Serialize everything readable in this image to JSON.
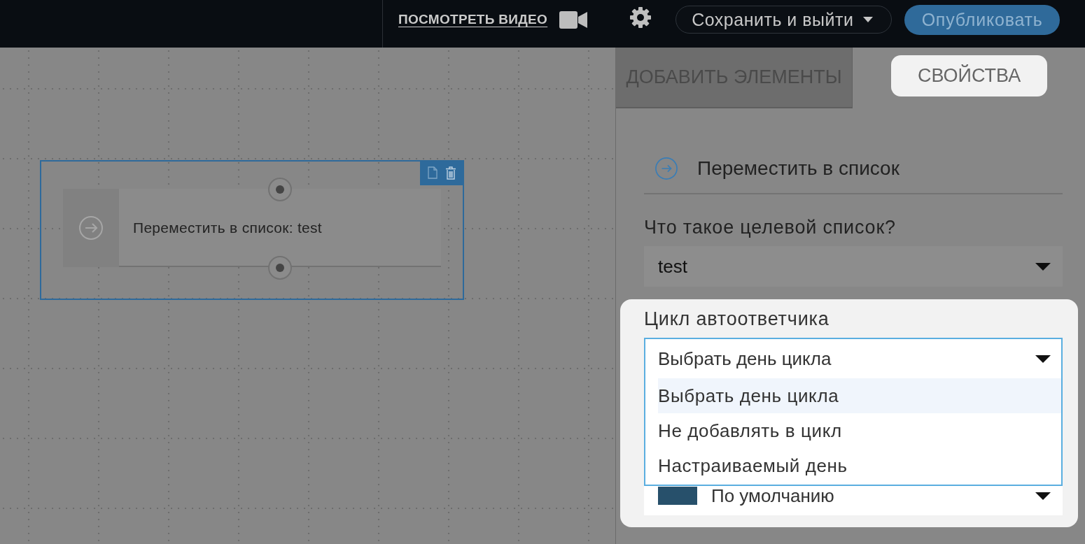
{
  "top_bar": {
    "video_link": "ПОСМОТРЕТЬ ВИДЕО",
    "save_button": "Сохранить и выйти",
    "publish_button": "Опубликовать"
  },
  "canvas": {
    "nodes": [
      {
        "label": "Переместить в список: test",
        "selected": true
      }
    ]
  },
  "panel": {
    "tabs": [
      {
        "label": "ДОБАВИТЬ ЭЛЕМЕНТЫ",
        "selected": false
      },
      {
        "label": "СВОЙСТВА",
        "selected": true
      }
    ],
    "heading": "Переместить в список",
    "fields": [
      {
        "kind": "select",
        "label": "Что такое целевой список?",
        "value": "test",
        "expanded": false,
        "highlighted": false
      },
      {
        "kind": "select",
        "label": "Цикл автоответчика",
        "value": "Выбрать день цикла",
        "expanded": true,
        "highlighted": true,
        "options": [
          {
            "label": "Выбрать день цикла",
            "selected": true
          },
          {
            "label": "Не добавлять в цикл",
            "selected": false
          },
          {
            "label": "Настраиваемый день",
            "selected": false
          }
        ]
      },
      {
        "kind": "color_select",
        "value": "По умолчанию",
        "color": "#27506b",
        "expanded": false,
        "highlighted": true
      }
    ]
  }
}
